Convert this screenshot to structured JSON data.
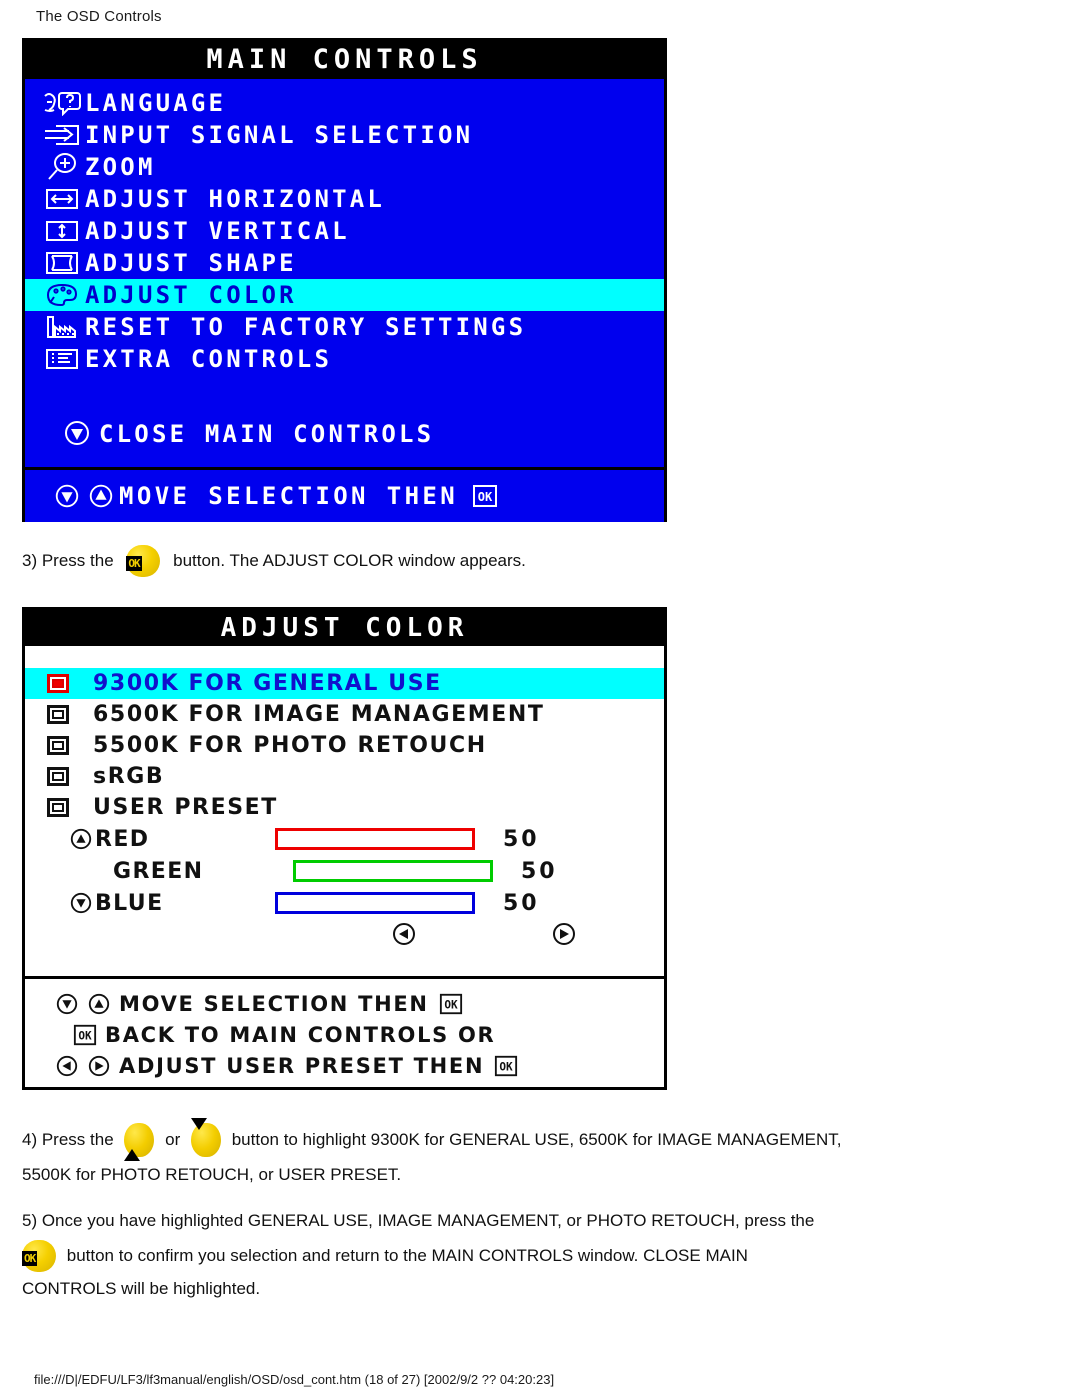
{
  "page": {
    "header": "The OSD Controls",
    "footer_path": "file:///D|/EDFU/LF3/lf3manual/english/OSD/osd_cont.htm (18 of 27) [2002/9/2 ?? 04:20:23]"
  },
  "colors": {
    "osd_blue": "#0000EE",
    "highlight_cyan": "#00FFFF",
    "selected_text_blue": "#0000CC",
    "red": "#EE0000",
    "green": "#00CC00",
    "blue": "#0000DD",
    "button_yellow": "#F3CD00",
    "black": "#000000",
    "white": "#FFFFFF"
  },
  "main_controls": {
    "title": "MAIN CONTROLS",
    "items": [
      {
        "label": "LANGUAGE",
        "icon": "language-head-question-icon",
        "selected": false
      },
      {
        "label": "INPUT SIGNAL SELECTION",
        "icon": "input-signal-arrow-icon",
        "selected": false
      },
      {
        "label": "ZOOM",
        "icon": "zoom-magnifier-plus-icon",
        "selected": false
      },
      {
        "label": "ADJUST HORIZONTAL",
        "icon": "horizontal-arrows-icon",
        "selected": false
      },
      {
        "label": "ADJUST VERTICAL",
        "icon": "vertical-arrows-icon",
        "selected": false
      },
      {
        "label": "ADJUST SHAPE",
        "icon": "shape-frame-icon",
        "selected": false
      },
      {
        "label": "ADJUST COLOR",
        "icon": "color-palette-icon",
        "selected": true
      },
      {
        "label": "RESET TO FACTORY SETTINGS",
        "icon": "factory-icon",
        "selected": false
      },
      {
        "label": "EXTRA CONTROLS",
        "icon": "list-panel-icon",
        "selected": false
      }
    ],
    "close_item": {
      "label": "CLOSE MAIN CONTROLS",
      "icon": "down-triangle-button-icon"
    },
    "footer_hint": {
      "label": "MOVE SELECTION THEN",
      "icons": [
        "down-triangle-button-icon",
        "up-triangle-button-icon"
      ],
      "trailing_icon": "ok-button-icon"
    }
  },
  "adjust_color": {
    "title": "ADJUST COLOR",
    "presets": [
      {
        "label": "9300K FOR GENERAL USE",
        "selected": true
      },
      {
        "label": "6500K FOR IMAGE MANAGEMENT",
        "selected": false
      },
      {
        "label": "5500K FOR PHOTO RETOUCH",
        "selected": false
      },
      {
        "label": "sRGB",
        "selected": false
      },
      {
        "label": "USER PRESET",
        "selected": false
      }
    ],
    "sliders": [
      {
        "name": "RED",
        "value": "50",
        "percent": 50,
        "color": "#EE0000",
        "icon": "up-triangle-button-icon"
      },
      {
        "name": "GREEN",
        "value": "50",
        "percent": 50,
        "color": "#00CC00",
        "icon": "none"
      },
      {
        "name": "BLUE",
        "value": "50",
        "percent": 50,
        "color": "#0000DD",
        "icon": "down-triangle-button-icon"
      }
    ],
    "lr_buttons": {
      "left": "left-triangle-button-icon",
      "right": "right-triangle-button-icon"
    },
    "hints": [
      {
        "label": "MOVE SELECTION THEN",
        "lead_icons": [
          "down-triangle-button-icon",
          "up-triangle-button-icon"
        ],
        "trail_icon": "ok-button-icon"
      },
      {
        "label": "BACK TO MAIN CONTROLS OR",
        "lead_icons": [
          "ok-button-icon"
        ],
        "trail_icon": "none"
      },
      {
        "label": "ADJUST USER PRESET THEN",
        "lead_icons": [
          "left-triangle-button-icon",
          "right-triangle-button-icon"
        ],
        "trail_icon": "ok-button-icon"
      }
    ]
  },
  "steps": {
    "step3": {
      "pre": "3) Press the",
      "post": "button. The ADJUST COLOR window appears.",
      "icon": "ok-button-icon"
    },
    "step4": {
      "pre": "4) Press the",
      "mid": "or",
      "post": "button to highlight 9300K for GENERAL USE, 6500K for IMAGE MANAGEMENT,",
      "line2": "5500K for PHOTO RETOUCH, or USER PRESET.",
      "icon_up": "up-arrow-button-icon",
      "icon_down": "down-arrow-button-icon"
    },
    "step5": {
      "line1": "5) Once you have highlighted GENERAL USE, IMAGE MANAGEMENT, or PHOTO RETOUCH, press the",
      "line2": "button to confirm you selection and return to the MAIN CONTROLS window. CLOSE MAIN",
      "line3": "CONTROLS will be highlighted.",
      "icon": "ok-button-icon"
    }
  }
}
